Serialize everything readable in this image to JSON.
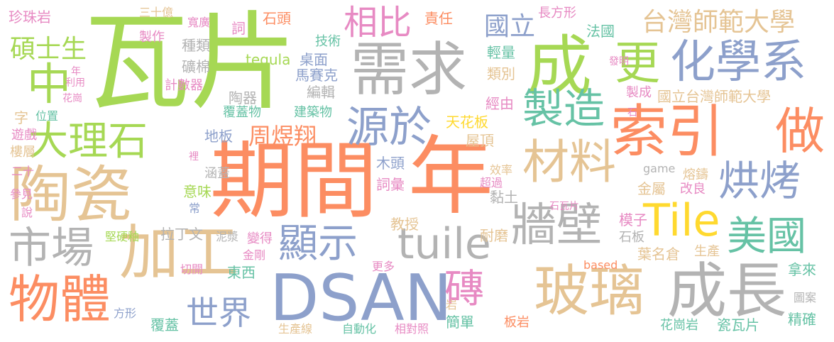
{
  "colors": {
    "green": "#a6d854",
    "coral": "#fc8d62",
    "blue": "#8da0cb",
    "grey": "#b3b3b3",
    "tan": "#e5c494",
    "teal": "#66c2a5",
    "pink": "#e78ac3",
    "yellow": "#ffd92f"
  },
  "words": [
    {
      "text": "瓦片",
      "color": "green"
    },
    {
      "text": "期間",
      "color": "coral"
    },
    {
      "text": "年",
      "color": "coral"
    },
    {
      "text": "陶瓷",
      "color": "tan"
    },
    {
      "text": "需求",
      "color": "grey"
    },
    {
      "text": "成",
      "color": "green"
    },
    {
      "text": "DSAN",
      "color": "blue"
    },
    {
      "text": "加工",
      "color": "tan"
    },
    {
      "text": "玻璃",
      "color": "tan"
    },
    {
      "text": "成長",
      "color": "grey"
    },
    {
      "text": "索引",
      "color": "coral"
    },
    {
      "text": "材料",
      "color": "tan"
    },
    {
      "text": "化學系",
      "color": "blue"
    },
    {
      "text": "製造",
      "color": "teal"
    },
    {
      "text": "源於",
      "color": "blue"
    },
    {
      "text": "tuile",
      "color": "grey"
    },
    {
      "text": "牆壁",
      "color": "grey"
    },
    {
      "text": "Tile",
      "color": "yellow"
    },
    {
      "text": "美國",
      "color": "teal"
    },
    {
      "text": "烘烤",
      "color": "blue"
    },
    {
      "text": "更",
      "color": "green"
    },
    {
      "text": "做",
      "color": "coral"
    },
    {
      "text": "物體",
      "color": "coral"
    },
    {
      "text": "市場",
      "color": "grey"
    },
    {
      "text": "大理石",
      "color": "green"
    },
    {
      "text": "中",
      "color": "green"
    },
    {
      "text": "顯示",
      "color": "blue"
    },
    {
      "text": "世界",
      "color": "blue"
    },
    {
      "text": "磚",
      "color": "pink"
    },
    {
      "text": "相比",
      "color": "pink"
    },
    {
      "text": "台灣師範大學",
      "color": "tan"
    },
    {
      "text": "碩士生",
      "color": "green"
    },
    {
      "text": "國立",
      "color": "blue"
    },
    {
      "text": "周煜翔",
      "color": "coral"
    },
    {
      "text": "珍珠岩",
      "color": "pink"
    },
    {
      "text": "三十億",
      "color": "tan"
    },
    {
      "text": "寬廣",
      "color": "pink"
    },
    {
      "text": "石頭",
      "color": "coral"
    },
    {
      "text": "責任",
      "color": "coral"
    },
    {
      "text": "長方形",
      "color": "pink"
    },
    {
      "text": "法國",
      "color": "teal"
    },
    {
      "text": "詞",
      "color": "pink"
    },
    {
      "text": "製作",
      "color": "pink"
    },
    {
      "text": "種類",
      "color": "grey"
    },
    {
      "text": "技術",
      "color": "teal"
    },
    {
      "text": "輕量",
      "color": "teal"
    },
    {
      "text": "tegula",
      "color": "green"
    },
    {
      "text": "桌面",
      "color": "blue"
    },
    {
      "text": "礦棉",
      "color": "grey"
    },
    {
      "text": "馬賽克",
      "color": "blue"
    },
    {
      "text": "類別",
      "color": "tan"
    },
    {
      "text": "發明",
      "color": "pink"
    },
    {
      "text": "計數器",
      "color": "pink"
    },
    {
      "text": "編輯",
      "color": "grey"
    },
    {
      "text": "陶器",
      "color": "grey"
    },
    {
      "text": "國立台灣師範大學",
      "color": "tan"
    },
    {
      "text": "製成",
      "color": "pink"
    },
    {
      "text": "經由",
      "color": "pink"
    },
    {
      "text": "覆蓋物",
      "color": "teal"
    },
    {
      "text": "建築物",
      "color": "teal"
    },
    {
      "text": "天花板",
      "color": "yellow"
    },
    {
      "text": "地板",
      "color": "blue"
    },
    {
      "text": "屋頂",
      "color": "tan"
    },
    {
      "text": "木頭",
      "color": "blue"
    },
    {
      "text": "涵蓋",
      "color": "grey"
    },
    {
      "text": "意味",
      "color": "green"
    },
    {
      "text": "效率",
      "color": "tan"
    },
    {
      "text": "超過",
      "color": "pink"
    },
    {
      "text": "game",
      "color": "grey"
    },
    {
      "text": "熔鑄",
      "color": "tan"
    },
    {
      "text": "改良",
      "color": "pink"
    },
    {
      "text": "詞彙",
      "color": "pink"
    },
    {
      "text": "黏土",
      "color": "grey"
    },
    {
      "text": "金屬",
      "color": "tan"
    },
    {
      "text": "石瓦片",
      "color": "pink"
    },
    {
      "text": "教授",
      "color": "tan"
    },
    {
      "text": "拉丁文",
      "color": "grey"
    },
    {
      "text": "堅硬釉",
      "color": "green"
    },
    {
      "text": "泥漿",
      "color": "grey"
    },
    {
      "text": "變得",
      "color": "pink"
    },
    {
      "text": "耐磨",
      "color": "tan"
    },
    {
      "text": "模子",
      "color": "pink"
    },
    {
      "text": "石板",
      "color": "grey"
    },
    {
      "text": "葉名倉",
      "color": "tan"
    },
    {
      "text": "生產",
      "color": "tan"
    },
    {
      "text": "金剛",
      "color": "pink"
    },
    {
      "text": "東西",
      "color": "teal"
    },
    {
      "text": "更多",
      "color": "pink"
    },
    {
      "text": "based",
      "color": "coral"
    },
    {
      "text": "拿來",
      "color": "teal"
    },
    {
      "text": "切開",
      "color": "pink"
    },
    {
      "text": "方形",
      "color": "blue"
    },
    {
      "text": "覆蓋",
      "color": "teal"
    },
    {
      "text": "岩",
      "color": "tan"
    },
    {
      "text": "板岩",
      "color": "coral"
    },
    {
      "text": "圖案",
      "color": "grey"
    },
    {
      "text": "精確",
      "color": "teal"
    },
    {
      "text": "生產線",
      "color": "tan"
    },
    {
      "text": "自動化",
      "color": "teal"
    },
    {
      "text": "相對照",
      "color": "pink"
    },
    {
      "text": "簡單",
      "color": "teal"
    },
    {
      "text": "花崗岩",
      "color": "teal"
    },
    {
      "text": "瓷瓦片",
      "color": "teal"
    },
    {
      "text": "年",
      "color": "pink"
    },
    {
      "text": "利用",
      "color": "pink"
    },
    {
      "text": "花崗",
      "color": "pink"
    },
    {
      "text": "字",
      "color": "tan"
    },
    {
      "text": "位置",
      "color": "teal"
    },
    {
      "text": "遊戲",
      "color": "pink"
    },
    {
      "text": "樓層",
      "color": "tan"
    },
    {
      "text": "二十",
      "color": "pink"
    },
    {
      "text": "參見",
      "color": "pink"
    },
    {
      "text": "說",
      "color": "pink"
    },
    {
      "text": "裡",
      "color": "pink"
    },
    {
      "text": "常",
      "color": "blue"
    },
    {
      "text": "石",
      "color": "pink"
    }
  ]
}
